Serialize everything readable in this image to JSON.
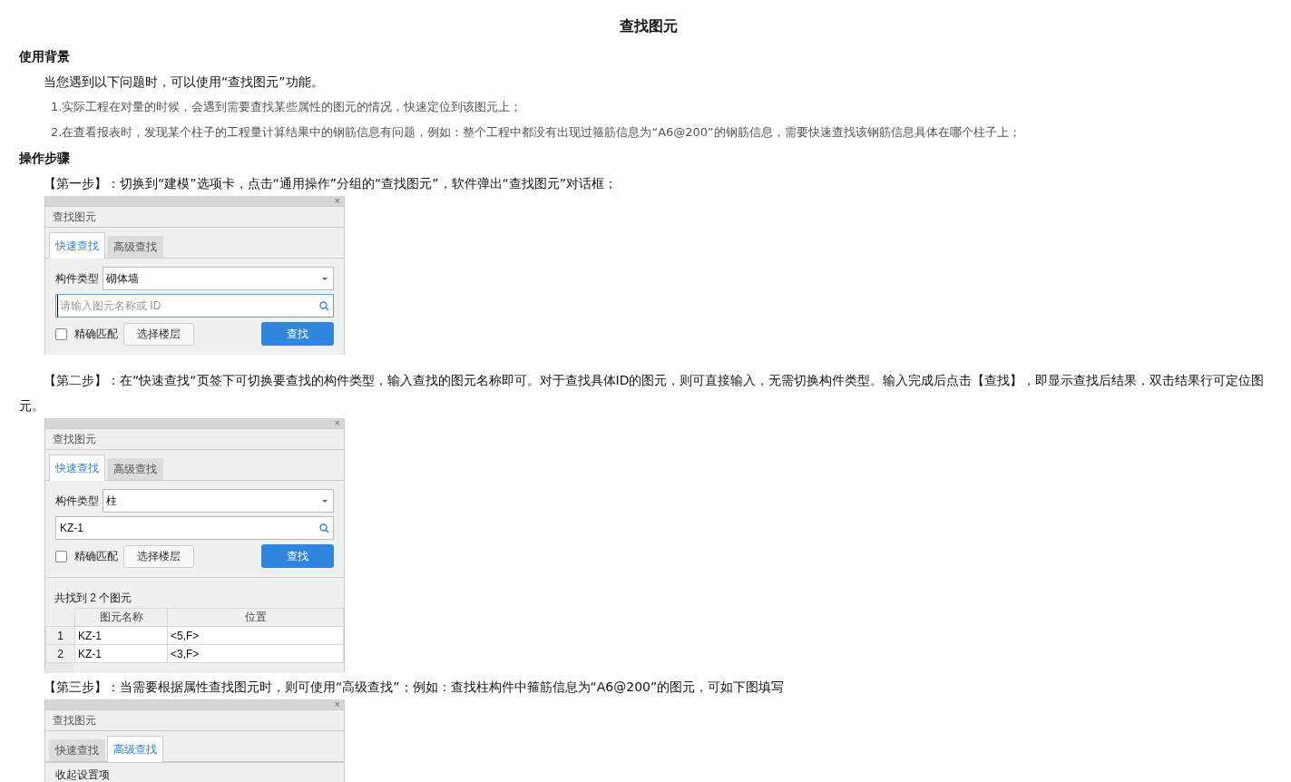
{
  "title": "查找图元",
  "sections": [
    {
      "heading": "使用背景",
      "blocks": [
        {
          "kind": "paragraph",
          "text": "当您遇到以下问题时，可以使用“查找图元”功能。"
        },
        {
          "kind": "list_item",
          "text": "1.实际工程在对量的时候，会遇到需要查找某些属性的图元的情况，快速定位到该图元上；"
        },
        {
          "kind": "list_item",
          "text": "2.在查看报表时，发现某个柱子的工程量计算结果中的钢筋信息有问题，例如：整个工程中都没有出现过箍筋信息为“A6@200”的钢筋信息，需要快速查找该钢筋信息具体在哪个柱子上；"
        }
      ]
    },
    {
      "heading": "操作步骤",
      "blocks": [
        {
          "kind": "paragraph",
          "text": "【第一步】：切换到“建模”选项卡，点击“通用操作”分组的“查找图元”，软件弹出“查找图元”对话框；"
        },
        {
          "kind": "dialog",
          "close": "×",
          "title": "查找图元",
          "tabs": [
            {
              "label": "快速查找",
              "selected": true
            },
            {
              "label": "高级查找",
              "selected": false
            }
          ],
          "form": {
            "type_label": "构件类型",
            "type_value": "砌体墙",
            "search_placeholder": "请输入图元名称或 ID",
            "exact_match": {
              "label": "精确匹配",
              "checked": false
            },
            "floor_button": "选择楼层",
            "find_button": "查找"
          }
        },
        {
          "kind": "paragraph",
          "text": "【第二步】：在“快速查找“页签下可切换要查找的构件类型，输入查找的图元名称即可。对于查找具体ID的图元，则可直接输入，无需切换构件类型。输入完成后点击【查找】，即显示查找后结果，双击结果行可定位图元。"
        },
        {
          "kind": "dialog",
          "close": "×",
          "title": "查找图元",
          "tabs": [
            {
              "label": "快速查找",
              "selected": true
            },
            {
              "label": "高级查找",
              "selected": false
            }
          ],
          "form": {
            "type_label": "构件类型",
            "type_value": "柱",
            "search_value": "KZ-1",
            "exact_match": {
              "label": "精确匹配",
              "checked": false
            },
            "floor_button": "选择楼层",
            "find_button": "查找"
          },
          "results": {
            "count": "共找到 2 个图元",
            "columns": [
              "图元名称",
              "位置"
            ],
            "rows": [
              {
                "index": "1",
                "cells": [
                  "KZ-1",
                  "<5,F>"
                ]
              },
              {
                "index": "2",
                "cells": [
                  "KZ-1",
                  "<3,F>"
                ]
              }
            ]
          }
        },
        {
          "kind": "paragraph",
          "text": "【第三步】：当需要根据属性查找图元时，则可使用“高级查找”；例如：查找柱构件中箍筋信息为“A6@200”的图元，可如下图填写"
        },
        {
          "kind": "dialog",
          "close": "×",
          "title": "查找图元",
          "tabs": [
            {
              "label": "快速查找",
              "selected": false
            },
            {
              "label": "高级查找",
              "selected": true
            }
          ],
          "collapse_label": "收起设置项"
        }
      ]
    }
  ]
}
